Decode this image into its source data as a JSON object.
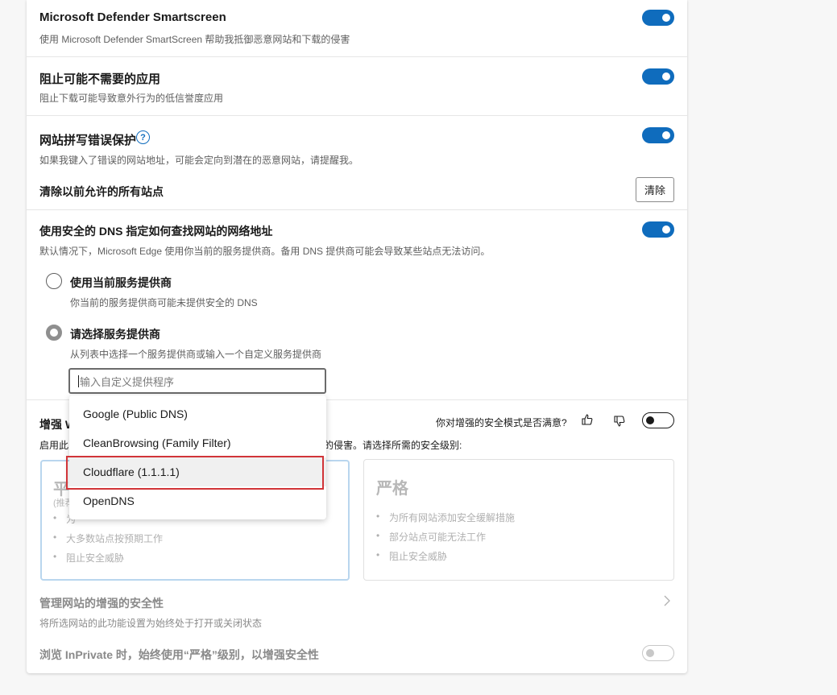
{
  "smartscreen": {
    "title": "Microsoft Defender Smartscreen",
    "desc": "使用 Microsoft Defender SmartScreen 帮助我抵御恶意网站和下载的侵害",
    "enabled": true
  },
  "pua": {
    "title": "阻止可能不需要的应用",
    "desc": "阻止下载可能导致意外行为的低信誉度应用",
    "enabled": true
  },
  "typo": {
    "title": "网站拼写错误保护",
    "help": "?",
    "desc": "如果我键入了错误的网站地址，可能会定向到潜在的恶意网站，请提醒我。",
    "enabled": true,
    "clear_title": "清除以前允许的所有站点",
    "clear_button": "清除"
  },
  "dns": {
    "title": "使用安全的 DNS 指定如何查找网站的网络地址",
    "desc": "默认情况下，Microsoft Edge 使用你当前的服务提供商。备用 DNS 提供商可能会导致某些站点无法访问。",
    "enabled": true,
    "option_current": {
      "label": "使用当前服务提供商",
      "desc": "你当前的服务提供商可能未提供安全的 DNS"
    },
    "option_choose": {
      "label": "请选择服务提供商",
      "desc": "从列表中选择一个服务提供商或输入一个自定义服务提供商"
    },
    "input_placeholder": "输入自定义提供程序",
    "providers": [
      "Google (Public DNS)",
      "CleanBrowsing (Family Filter)",
      "Cloudflare (1.1.1.1)",
      "OpenDNS"
    ]
  },
  "enhanced": {
    "title_fragment": "增强 W",
    "feedback_question": "你对增强的安全模式是否满意?",
    "desc_left": "启用此",
    "desc_right": "的侵害。请选择所需的安全级别:",
    "enabled": false,
    "balanced": {
      "title_fragment": "平",
      "sub_fragment": "(推荐",
      "bullets": [
        "为",
        "大多数站点按预期工作",
        "阻止安全威胁"
      ]
    },
    "strict": {
      "title": "严格",
      "bullets": [
        "为所有网站添加安全缓解措施",
        "部分站点可能无法工作",
        "阻止安全威胁"
      ]
    }
  },
  "manage": {
    "title": "管理网站的增强的安全性",
    "desc": "将所选网站的此功能设置为始终处于打开或关闭状态"
  },
  "inprivate": {
    "title": "浏览 InPrivate 时，始终使用“严格”级别，以增强安全性",
    "enabled": false
  },
  "colors": {
    "accent": "#0f6cbd",
    "highlight_box": "#d13438"
  }
}
